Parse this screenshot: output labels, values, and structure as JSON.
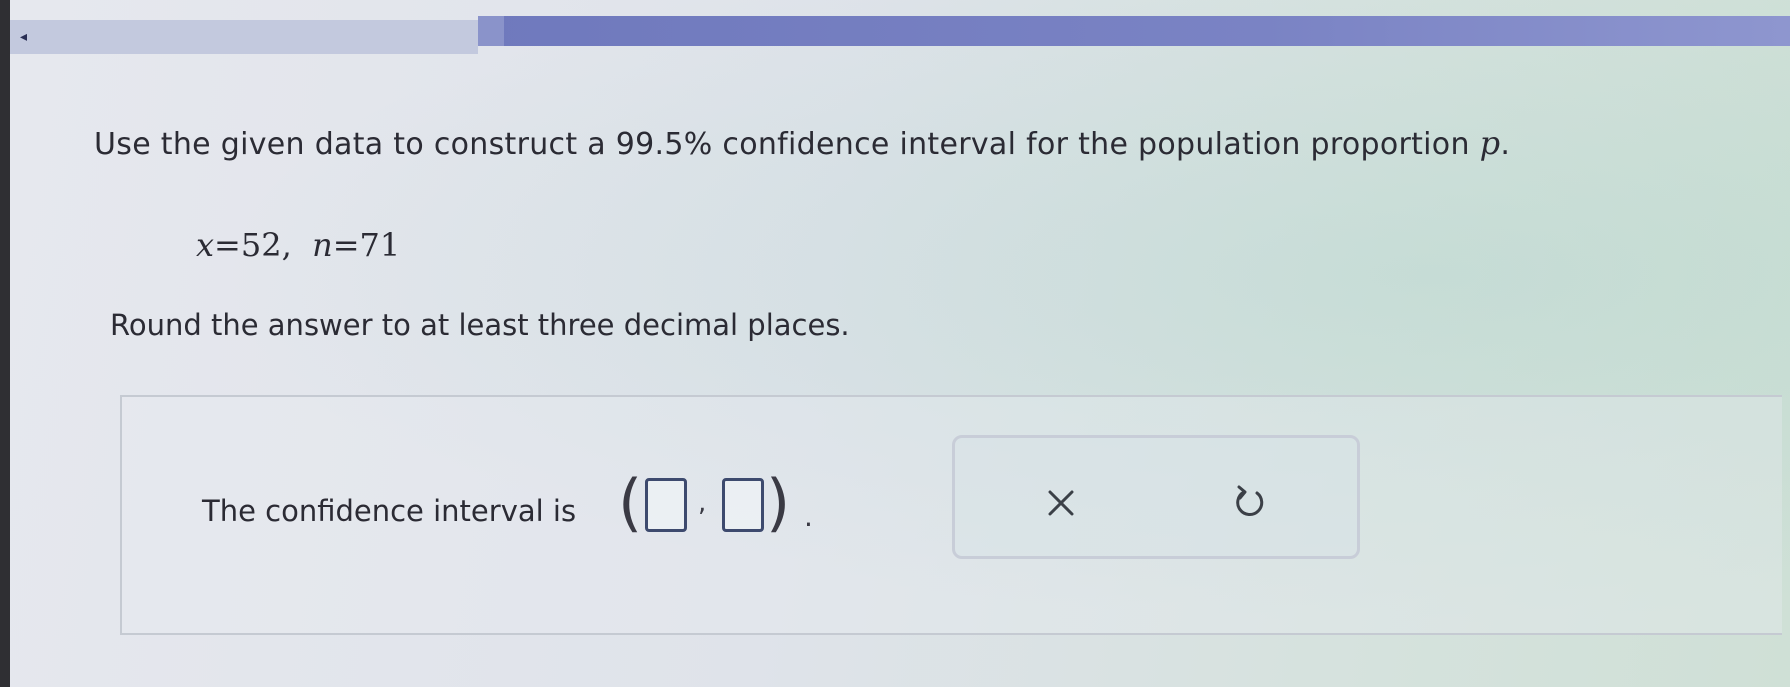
{
  "header": {
    "back_glyph": "◂"
  },
  "question": {
    "prompt_before": "Use the given data to construct a 99.5% confidence interval for the population proportion ",
    "prompt_var": "p",
    "prompt_after": ".",
    "data": {
      "x_var": "x",
      "x_value": "=52,",
      "n_var": "n",
      "n_value": "=71"
    },
    "instruction": "Round the answer to at least three decimal places."
  },
  "answer": {
    "label": "The confidence interval is",
    "open_paren": "(",
    "separator": ",",
    "close_paren": ")",
    "terminator": ".",
    "lower_value": "",
    "upper_value": ""
  },
  "actions": {
    "clear_icon": "close-icon",
    "undo_icon": "undo-icon"
  }
}
